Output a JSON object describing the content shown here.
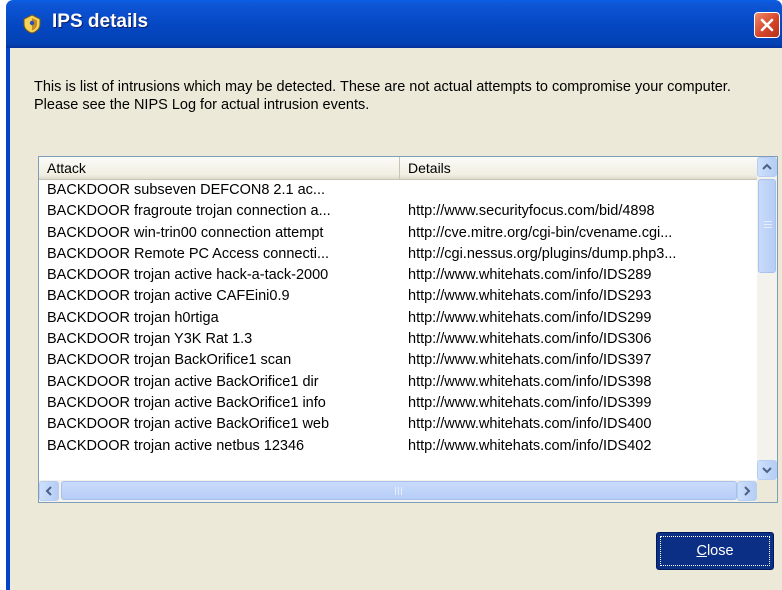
{
  "window": {
    "title": "IPS details",
    "icon": "ips-shield-icon",
    "close_icon": "close-icon"
  },
  "intro": {
    "text": "This is list of intrusions which may be detected. These are not actual attempts to compromise your computer. Please see the NIPS Log for actual intrusion events."
  },
  "table": {
    "columns": [
      "Attack",
      "Details"
    ],
    "rows": [
      {
        "attack": "BACKDOOR subseven DEFCON8 2.1 ac...",
        "details": ""
      },
      {
        "attack": "BACKDOOR fragroute trojan connection a...",
        "details": "http://www.securityfocus.com/bid/4898"
      },
      {
        "attack": "BACKDOOR win-trin00 connection attempt",
        "details": "http://cve.mitre.org/cgi-bin/cvename.cgi..."
      },
      {
        "attack": "BACKDOOR Remote PC Access connecti...",
        "details": "http://cgi.nessus.org/plugins/dump.php3..."
      },
      {
        "attack": "BACKDOOR trojan active hack-a-tack-2000",
        "details": "http://www.whitehats.com/info/IDS289"
      },
      {
        "attack": "BACKDOOR trojan active CAFEini0.9",
        "details": "http://www.whitehats.com/info/IDS293"
      },
      {
        "attack": "BACKDOOR trojan h0rtiga",
        "details": "http://www.whitehats.com/info/IDS299"
      },
      {
        "attack": "BACKDOOR trojan Y3K Rat 1.3",
        "details": "http://www.whitehats.com/info/IDS306"
      },
      {
        "attack": "BACKDOOR trojan BackOrifice1 scan",
        "details": "http://www.whitehats.com/info/IDS397"
      },
      {
        "attack": "BACKDOOR trojan active BackOrifice1 dir",
        "details": "http://www.whitehats.com/info/IDS398"
      },
      {
        "attack": "BACKDOOR trojan active BackOrifice1 info",
        "details": "http://www.whitehats.com/info/IDS399"
      },
      {
        "attack": "BACKDOOR trojan active BackOrifice1 web",
        "details": "http://www.whitehats.com/info/IDS400"
      },
      {
        "attack": "BACKDOOR trojan active netbus 12346",
        "details": "http://www.whitehats.com/info/IDS402"
      }
    ]
  },
  "buttons": {
    "close_prefix": "",
    "close_accel": "C",
    "close_rest": "lose"
  },
  "colors": {
    "titlebar": "#0548c4",
    "dialog_bg": "#ece9d8",
    "close_button_bg": "#0c2f86"
  }
}
